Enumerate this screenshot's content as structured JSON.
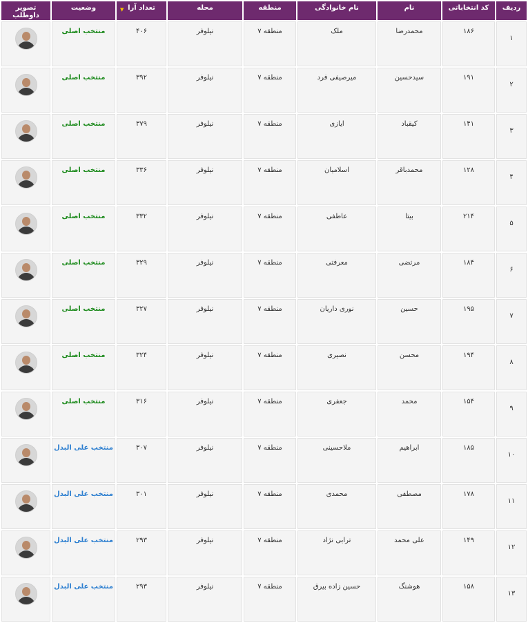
{
  "headers": {
    "row": "ردیف",
    "code": "کد انتخاباتی",
    "first_name": "نام",
    "last_name": "نام خانوادگی",
    "region": "منطقه",
    "district": "محله",
    "votes": "تعداد آرا",
    "status": "وضعیت",
    "photo": "تصویر داوطلب"
  },
  "sort_indicator": "▼",
  "status_colors": {
    "main": "#1c8a1c",
    "alternate": "#2d7fd0"
  },
  "rows": [
    {
      "num": "۱",
      "code": "۱۸۶",
      "first": "محمدرضا",
      "last": "ملک",
      "region": "منطقه ۷",
      "district": "نیلوفر",
      "votes": "۴۰۶",
      "status": "منتخب اصلی",
      "status_type": "main"
    },
    {
      "num": "۲",
      "code": "۱۹۱",
      "first": "سیدحسین",
      "last": "میرصیفی فرد",
      "region": "منطقه ۷",
      "district": "نیلوفر",
      "votes": "۳۹۲",
      "status": "منتخب اصلی",
      "status_type": "main"
    },
    {
      "num": "۳",
      "code": "۱۴۱",
      "first": "کیقباد",
      "last": "ایازی",
      "region": "منطقه ۷",
      "district": "نیلوفر",
      "votes": "۳۷۹",
      "status": "منتخب اصلی",
      "status_type": "main"
    },
    {
      "num": "۴",
      "code": "۱۲۸",
      "first": "محمدباقر",
      "last": "اسلامیان",
      "region": "منطقه ۷",
      "district": "نیلوفر",
      "votes": "۳۳۶",
      "status": "منتخب اصلی",
      "status_type": "main"
    },
    {
      "num": "۵",
      "code": "۲۱۴",
      "first": "بیتا",
      "last": "عاطفی",
      "region": "منطقه ۷",
      "district": "نیلوفر",
      "votes": "۳۳۲",
      "status": "منتخب اصلی",
      "status_type": "main"
    },
    {
      "num": "۶",
      "code": "۱۸۴",
      "first": "مرتضی",
      "last": "معرفتی",
      "region": "منطقه ۷",
      "district": "نیلوفر",
      "votes": "۳۲۹",
      "status": "منتخب اصلی",
      "status_type": "main"
    },
    {
      "num": "۷",
      "code": "۱۹۵",
      "first": "حسین",
      "last": "نوری داریان",
      "region": "منطقه ۷",
      "district": "نیلوفر",
      "votes": "۳۲۷",
      "status": "منتخب اصلی",
      "status_type": "main"
    },
    {
      "num": "۸",
      "code": "۱۹۴",
      "first": "محسن",
      "last": "نصیری",
      "region": "منطقه ۷",
      "district": "نیلوفر",
      "votes": "۳۲۴",
      "status": "منتخب اصلی",
      "status_type": "main"
    },
    {
      "num": "۹",
      "code": "۱۵۴",
      "first": "محمد",
      "last": "جعفری",
      "region": "منطقه ۷",
      "district": "نیلوفر",
      "votes": "۳۱۶",
      "status": "منتخب اصلی",
      "status_type": "main"
    },
    {
      "num": "۱۰",
      "code": "۱۸۵",
      "first": "ابراهیم",
      "last": "ملاحسینی",
      "region": "منطقه ۷",
      "district": "نیلوفر",
      "votes": "۳۰۷",
      "status": "منتخب علی البدل",
      "status_type": "alternate"
    },
    {
      "num": "۱۱",
      "code": "۱۷۸",
      "first": "مصطفی",
      "last": "محمدی",
      "region": "منطقه ۷",
      "district": "نیلوفر",
      "votes": "۳۰۱",
      "status": "منتخب علی البدل",
      "status_type": "alternate"
    },
    {
      "num": "۱۲",
      "code": "۱۴۹",
      "first": "علی محمد",
      "last": "ترابی نژاد",
      "region": "منطقه ۷",
      "district": "نیلوفر",
      "votes": "۲۹۳",
      "status": "منتخب علی البدل",
      "status_type": "alternate"
    },
    {
      "num": "۱۳",
      "code": "۱۵۸",
      "first": "هوشنگ",
      "last": "حسین زاده بیرق",
      "region": "منطقه ۷",
      "district": "نیلوفر",
      "votes": "۲۹۳",
      "status": "منتخب علی البدل",
      "status_type": "alternate"
    }
  ]
}
